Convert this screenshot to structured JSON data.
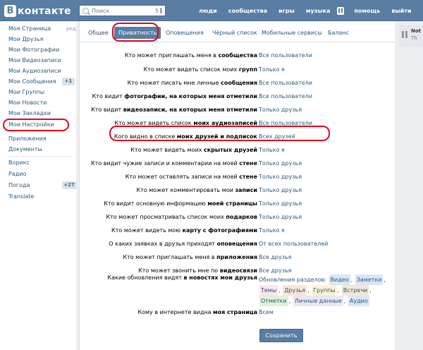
{
  "header": {
    "logo_letter": "B",
    "logo_text": "контакте",
    "search_placeholder": "Поиск",
    "search_count": "5",
    "nav": [
      "люди",
      "сообщества",
      "игры",
      "музыка",
      "помощь",
      "выйти"
    ]
  },
  "sidebar": {
    "items": [
      {
        "label": "Моя Страница",
        "extra": "ред."
      },
      {
        "label": "Мои Друзья"
      },
      {
        "label": "Мои Фотографии"
      },
      {
        "label": "Мои Видеозаписи"
      },
      {
        "label": "Мои Аудиозаписи"
      },
      {
        "label": "Мои Сообщения",
        "badge": "+1"
      },
      {
        "label": "Мои Группы"
      },
      {
        "label": "Мои Новости"
      },
      {
        "label": "Мои Закладки"
      },
      {
        "label": "Мои Настройки"
      },
      {
        "label": "Приложения"
      },
      {
        "label": "Документы"
      },
      {
        "label": "Ворикс"
      },
      {
        "label": "Радио"
      },
      {
        "label": "Погода",
        "badge": "+27"
      },
      {
        "label": "Translate"
      }
    ]
  },
  "tabs": [
    "Общее",
    "Приватность",
    "Оповещения",
    "Чёрный список",
    "Мобильные сервисы",
    "Баланс"
  ],
  "active_tab": "Приватность",
  "settings": [
    {
      "pre": "Кто может приглашать меня в ",
      "bold": "сообщества",
      "post": "",
      "value": "Все пользователи"
    },
    {
      "pre": "Кто может видеть список моих ",
      "bold": "групп",
      "post": "",
      "value": "Только я"
    },
    {
      "pre": "Кто может писать мне личные ",
      "bold": "сообщения",
      "post": "",
      "value": "Все пользователи"
    },
    {
      "pre": "Кто видит ",
      "bold": "фотографии, на которых меня отметили",
      "post": "",
      "value": "Все пользователи"
    },
    {
      "pre": "Кто видит ",
      "bold": "видеозаписи, на которых меня отметили",
      "post": "",
      "value": "Только друзья"
    },
    {
      "pre": "Кто может видеть список ",
      "bold": "моих аудиозаписей",
      "post": "",
      "value": "Все пользователи"
    },
    {
      "pre": "Кого видно в списке ",
      "bold": "моих друзей и подписок",
      "post": "",
      "value": "Всех друзей"
    },
    {
      "pre": "Кто может видеть моих ",
      "bold": "скрытых друзей",
      "post": "",
      "value": "Только я"
    },
    {
      "pre": "Кто видит чужие записи и комментарии на моей ",
      "bold": "стене",
      "post": "",
      "value": "Только друзья"
    },
    {
      "pre": "Кто может оставлять записи на моей ",
      "bold": "стене",
      "post": "",
      "value": "Только друзья"
    },
    {
      "pre": "Кто может комментировать мои ",
      "bold": "записи",
      "post": "",
      "value": "Только друзья"
    },
    {
      "pre": "Кто видит основную информацию ",
      "bold": "моей страницы",
      "post": "",
      "value": "Только друзья"
    },
    {
      "pre": "Кто может просматривать список моих ",
      "bold": "подарков",
      "post": "",
      "value": "Только друзья"
    },
    {
      "pre": "Кто может видеть мою ",
      "bold": "карту с фотографиями",
      "post": "",
      "value": "Только я"
    },
    {
      "pre": "О каких заявках в друзья приходят ",
      "bold": "оповещения",
      "post": "",
      "value": "От всех пользователей"
    },
    {
      "pre": "Кто может приглашать меня в ",
      "bold": "приложения",
      "post": "",
      "value": "Все друзья"
    },
    {
      "pre": "Кто может звонить мне по ",
      "bold": "видеосвязи",
      "post": "",
      "value": "Все друзья"
    }
  ],
  "news": {
    "pre": "Какие обновления видят ",
    "bold": "в новостях мои друзья",
    "value_label": "Обновления разделов:",
    "tags": [
      {
        "text": "Видео",
        "color": "#dae6f5"
      },
      {
        "text": "Заметки",
        "color": "#dae6f5"
      },
      {
        "text": "Темы",
        "color": "#fbe5ee"
      },
      {
        "text": "Друзья",
        "color": "#fbe5d7"
      },
      {
        "text": "Группы",
        "color": "#fbf3d3"
      },
      {
        "text": "Встречи",
        "color": "#f6e6d3"
      },
      {
        "text": "Отметки",
        "color": "#e0f1d9"
      },
      {
        "text": "Личные данные",
        "color": "#eae6f3"
      },
      {
        "text": "Аудио",
        "color": "#dae6f5"
      }
    ]
  },
  "internet": {
    "pre": "Кому в интернете видна ",
    "bold": "моя страница",
    "value": "Всем"
  },
  "save_label": "Сохранить",
  "right": {
    "t1": "Not",
    "t2": "Th"
  },
  "colors": {
    "header": "#597da3",
    "link": "#2b587a",
    "highlight": "#e3061a"
  }
}
